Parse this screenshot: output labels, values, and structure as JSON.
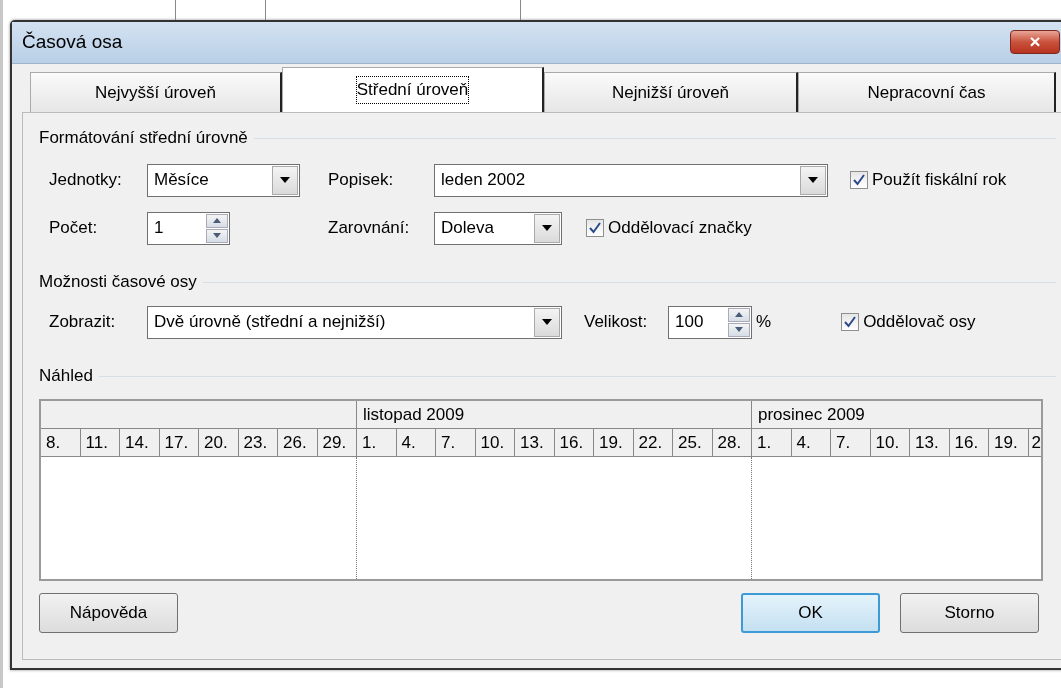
{
  "window": {
    "title": "Časová osa",
    "close_label": "×"
  },
  "tabs": [
    {
      "label": "Nejvyšší úroveň",
      "selected": false
    },
    {
      "label": "Střední úroveň",
      "selected": true
    },
    {
      "label": "Nejnižší úroveň",
      "selected": false
    },
    {
      "label": "Nepracovní čas",
      "selected": false
    }
  ],
  "format_group": {
    "title": "Formátování střední úrovně",
    "units": {
      "label": "Jednotky:",
      "value": "Měsíce"
    },
    "caption": {
      "label": "Popisek:",
      "value": "leden 2002"
    },
    "fiscal_year": {
      "label": "Použít fiskální rok",
      "checked": true
    },
    "count": {
      "label": "Počet:",
      "value": "1"
    },
    "align": {
      "label": "Zarovnání:",
      "value": "Doleva"
    },
    "tick_lines": {
      "label": "Oddělovací značky",
      "checked": true
    }
  },
  "options_group": {
    "title": "Možnosti časové osy",
    "show": {
      "label": "Zobrazit:",
      "value": "Dvě úrovně (střední a nejnižší)"
    },
    "size": {
      "label": "Velikost:",
      "value": "100",
      "unit": "%"
    },
    "separator": {
      "label": "Oddělovač osy",
      "checked": true
    }
  },
  "preview": {
    "title": "Náhled",
    "lead_days": [
      "8.",
      "11.",
      "14.",
      "17.",
      "20.",
      "23.",
      "26.",
      "29."
    ],
    "months": [
      {
        "label": "listopad 2009",
        "days": [
          "1.",
          "4.",
          "7.",
          "10.",
          "13.",
          "16.",
          "19.",
          "22.",
          "25.",
          "28."
        ]
      },
      {
        "label": "prosinec 2009",
        "days": [
          "1.",
          "4.",
          "7.",
          "10.",
          "13.",
          "16.",
          "19.",
          "2"
        ]
      }
    ]
  },
  "buttons": [
    {
      "label": "Nápověda",
      "kind": "normal"
    },
    {
      "label": "OK",
      "kind": "default"
    },
    {
      "label": "Storno",
      "kind": "normal"
    }
  ]
}
